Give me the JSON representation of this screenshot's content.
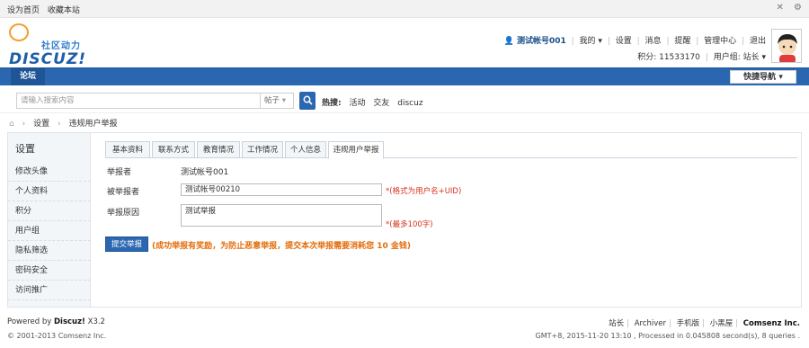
{
  "topbar": {
    "links": [
      "设为首页",
      "收藏本站"
    ],
    "icons": [
      "close-icon",
      "gear-icon"
    ]
  },
  "header": {
    "logo_slogan": "社区动力",
    "logo_brand": "DISCUZ!",
    "user": {
      "name": "测试帐号001",
      "menu": [
        "我的",
        "设置",
        "消息",
        "提醒",
        "管理中心",
        "退出"
      ],
      "points": "积分: 11533170",
      "group": "用户组: 站长"
    }
  },
  "navbar": {
    "home": "论坛",
    "quick_nav": "快捷导航"
  },
  "search": {
    "placeholder": "请输入搜索内容",
    "type": "帖子",
    "hot_label": "热搜:",
    "hot_words": [
      "活动",
      "交友",
      "discuz"
    ]
  },
  "breadcrumb": [
    "设置",
    "违规用户举报"
  ],
  "sidebar": {
    "title": "设置",
    "items": [
      "修改头像",
      "个人资料",
      "积分",
      "用户组",
      "隐私筛选",
      "密码安全",
      "访问推广"
    ]
  },
  "tabs": [
    {
      "label": "基本资料",
      "active": false
    },
    {
      "label": "联系方式",
      "active": false
    },
    {
      "label": "教育情况",
      "active": false
    },
    {
      "label": "工作情况",
      "active": false
    },
    {
      "label": "个人信息",
      "active": false
    },
    {
      "label": "违规用户举报",
      "active": true
    }
  ],
  "form": {
    "reporter_label": "举报者",
    "reporter_value": "测试帐号001",
    "target_label": "被举报者",
    "target_value": "测试帐号00210",
    "target_hint": "*(格式为用户名+UID)",
    "reason_label": "举报原因",
    "reason_value": "测试举报",
    "reason_hint": "*(最多100字)",
    "submit_label": "提交举报",
    "notice": "(成功举报有奖励，为防止恶意举报，提交本次举报需要消耗您 10 金钱)"
  },
  "footer": {
    "powered_prefix": "Powered by",
    "powered_name": "Discuz!",
    "powered_version": "X3.2",
    "copyright": "© 2001-2013 Comsenz Inc.",
    "links": [
      "站长",
      "Archiver",
      "手机版",
      "小黑屋",
      "Comsenz Inc."
    ],
    "stats": "GMT+8, 2015-11-20 13:10 , Processed in 0.045808 second(s), 8 queries ."
  },
  "colors": {
    "brand_blue": "#2b67b1",
    "hint_red": "#d9301d",
    "notice_orange": "#e36c0a"
  }
}
